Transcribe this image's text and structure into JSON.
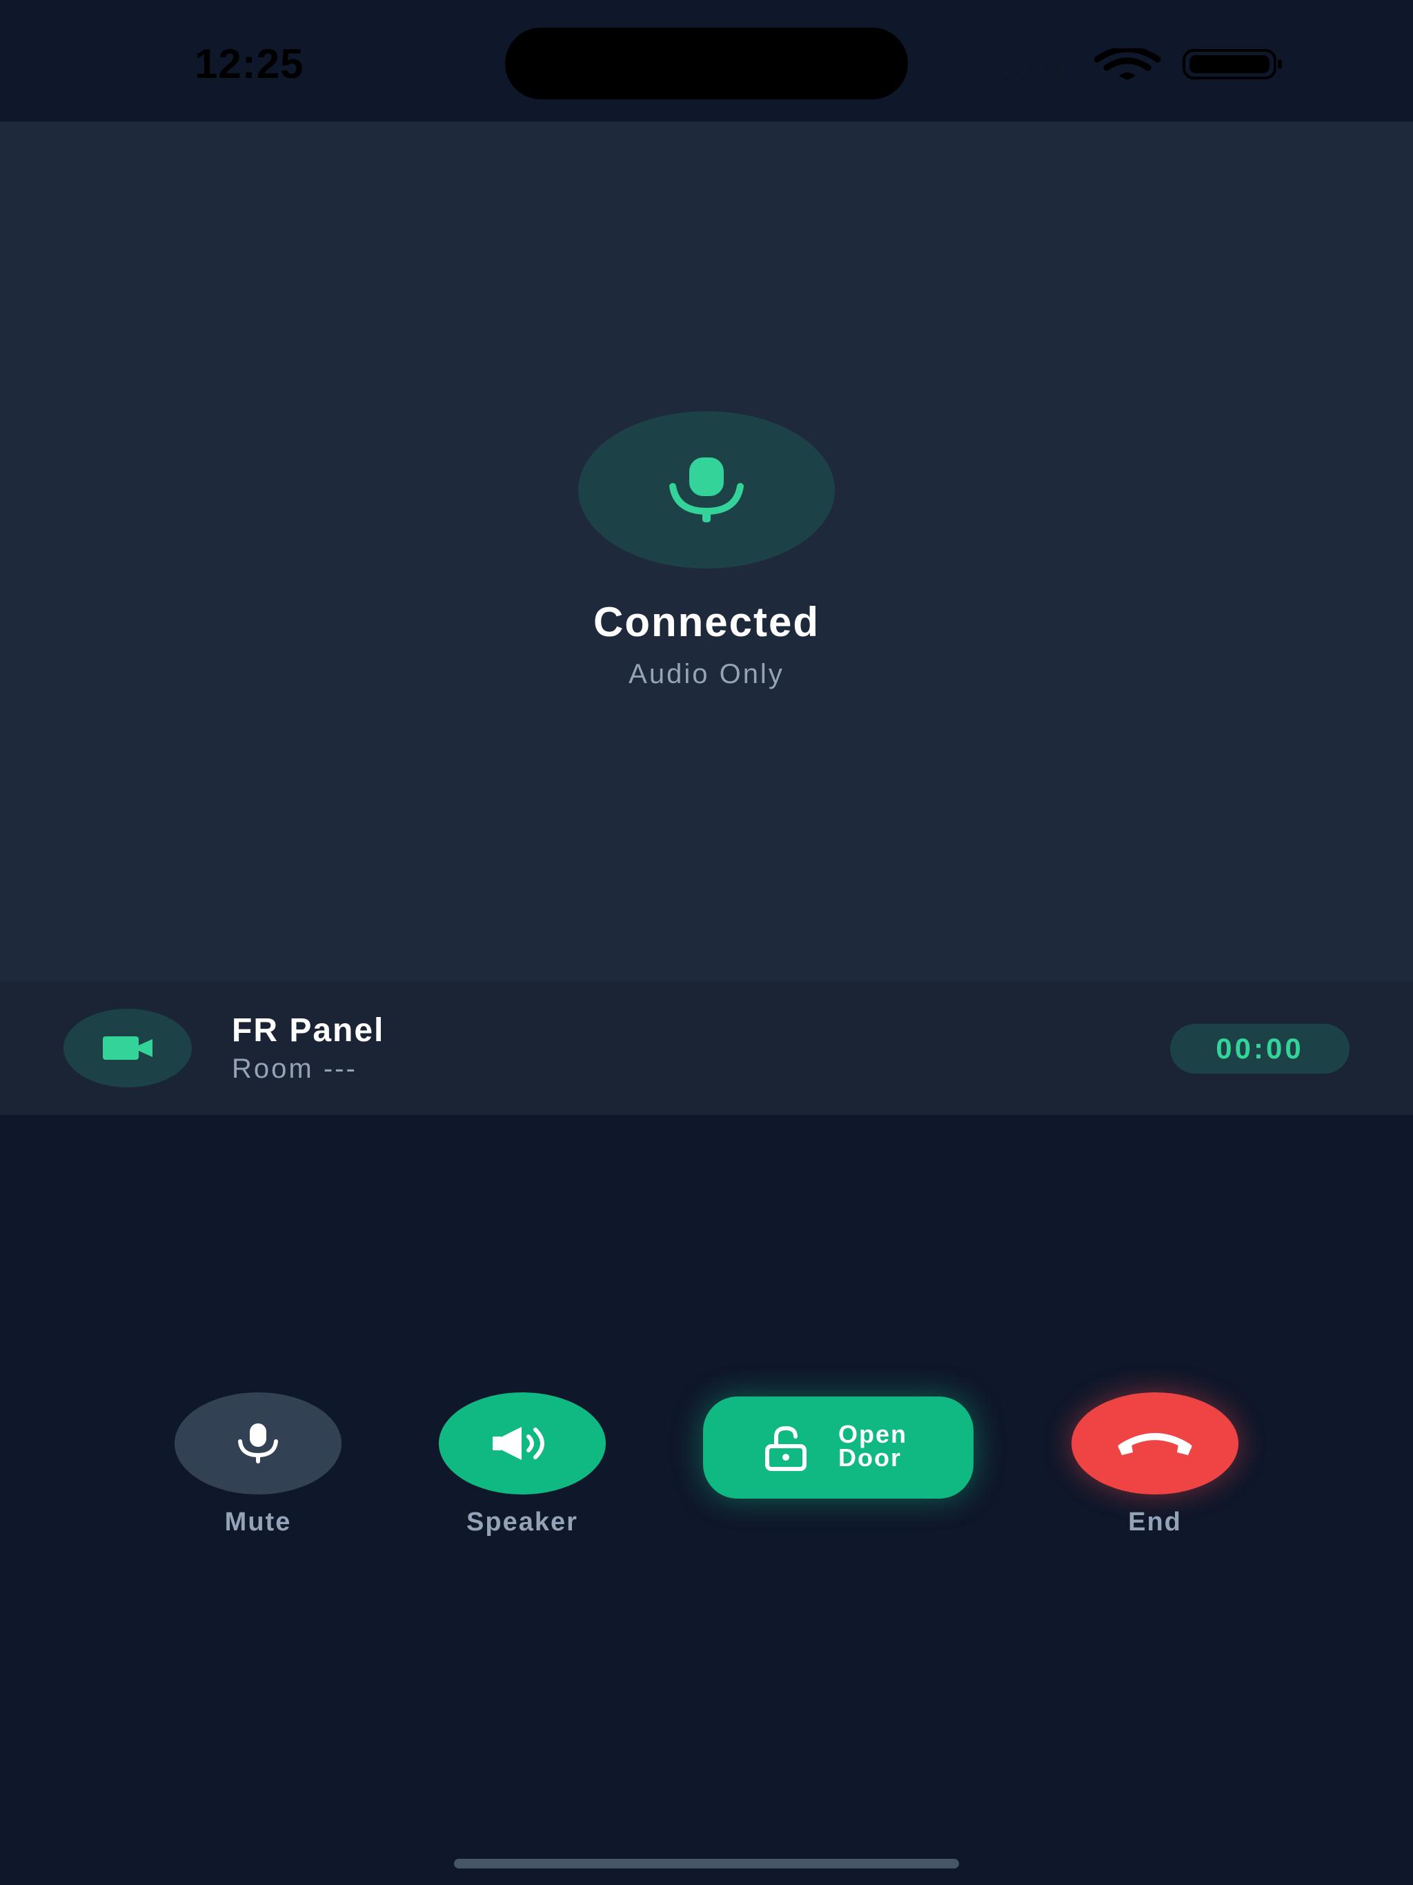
{
  "status_bar": {
    "time": "12:25"
  },
  "call": {
    "status": "Connected",
    "mode": "Audio Only"
  },
  "panel": {
    "name": "FR Panel",
    "room": "Room ---",
    "timer": "00:00"
  },
  "controls": {
    "mute_label": "Mute",
    "speaker_label": "Speaker",
    "open_door_line1": "Open",
    "open_door_line2": "Door",
    "end_label": "End"
  },
  "colors": {
    "background": "#0f172a",
    "call_area": "#1e293b",
    "accent_green": "#10b981",
    "icon_green": "#34d399",
    "end_red": "#ef4444",
    "muted_text": "#94a3b8"
  },
  "icons": {
    "call_mode": "microphone-icon",
    "panel": "video-camera-icon",
    "mute": "microphone-icon",
    "speaker": "speaker-icon",
    "open_door": "unlock-icon",
    "end": "phone-hangup-icon"
  }
}
